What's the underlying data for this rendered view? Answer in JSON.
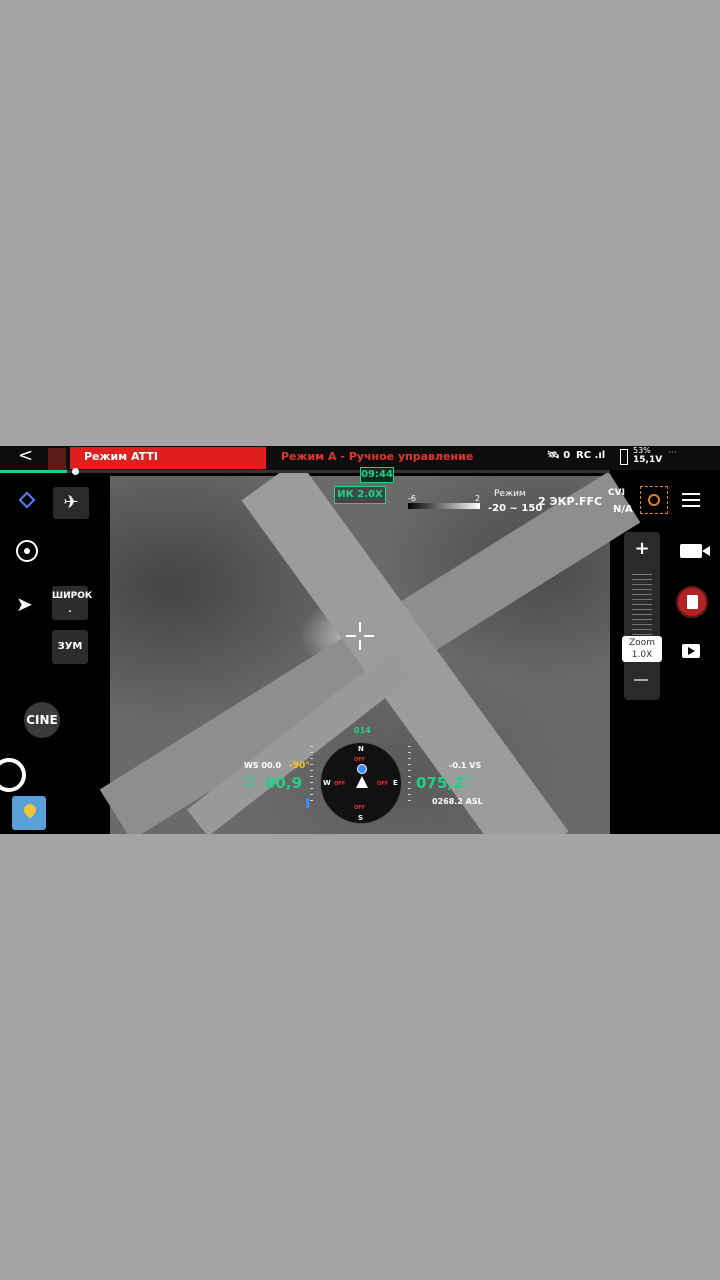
{
  "top_bar": {
    "back": "<",
    "flight_mode": "Режим ATTI",
    "control_mode": "Режим А - Ручное управление",
    "satellites": "0",
    "rc": "RC",
    "battery_top": "53%",
    "battery_voltage": "15,1V"
  },
  "timer": "09:44",
  "camera": {
    "ir_zoom": "ИК 2.0X",
    "scale_min": "-6",
    "scale_max": "2",
    "rezhim_label": "Режим",
    "rezhim_range": "-20 ~ 150",
    "screens": "2 ЭКР.",
    "ffc": "FFC",
    "cvi": "CVI",
    "na": "N/A"
  },
  "left_panel": {
    "wide_label": "ШИРОК",
    "wide_sub": ".",
    "zoom_label": "ЗУМ",
    "cine_label": "CINE"
  },
  "zoom": {
    "plus": "+",
    "label": "Zoom",
    "value": "1.0X"
  },
  "telemetry": {
    "ws": "WS 00.0",
    "gimbal_pitch": "-90°",
    "hs_tag": "SPD\nm/s",
    "hs_value": "00,9",
    "vs": "-0.1 VS",
    "alt_value": "075,2",
    "alt_tag": "ALT\nm",
    "asl": "0268.2 ASL",
    "heading": "014",
    "compass_n": "N",
    "compass_e": "E",
    "compass_w": "W",
    "compass_s": "S",
    "off": "OFF"
  },
  "flight_progress": 0.11,
  "colors": {
    "accent_green": "#1fd28a",
    "alert_red": "#e0201e",
    "gimbal_yellow": "#f5c518"
  }
}
